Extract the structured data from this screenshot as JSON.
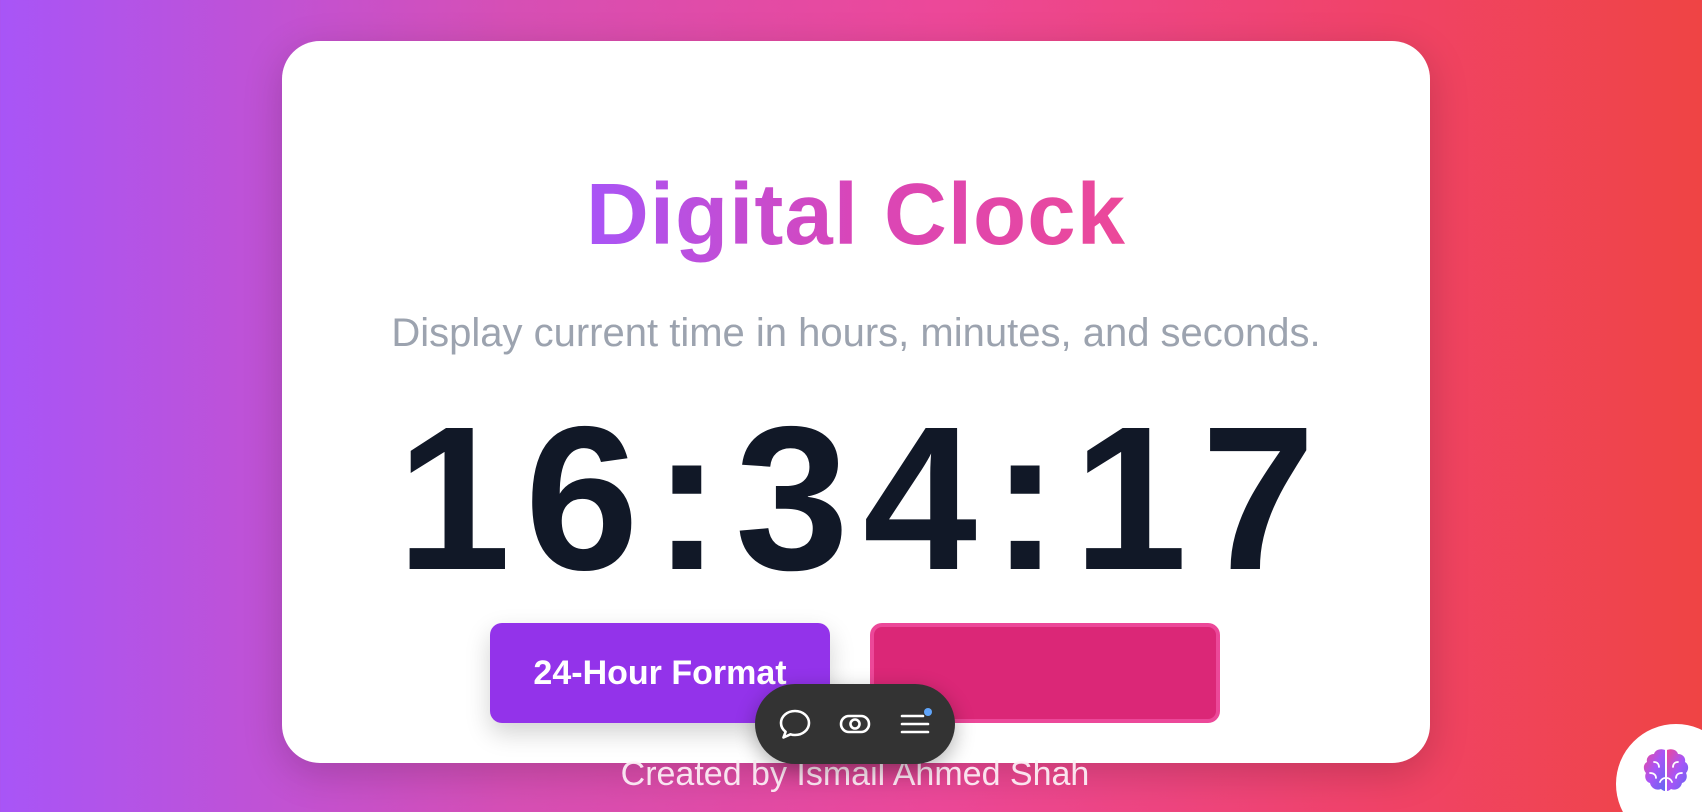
{
  "page": {
    "title": "Digital Clock",
    "subtitle": "Display current time in hours, minutes, and seconds.",
    "time": "16:34:17",
    "footer": "Created by Ismail Ahmed Shah"
  },
  "buttons": {
    "format_label": "24-Hour Format",
    "secondary_label": ""
  },
  "toolbar": {
    "icons": [
      "chat-bubble-icon",
      "eye-toggle-icon",
      "menu-icon"
    ],
    "notification_dot_color": "#60a5fa"
  },
  "colors": {
    "gradient_start": "#a855f7",
    "gradient_end": "#ef4444",
    "format_button": "#9333ea",
    "secondary_button": "#db2777",
    "clock_text": "#111827",
    "subtitle_text": "#9ca3af"
  },
  "widget": {
    "icon": "brain-icon"
  }
}
